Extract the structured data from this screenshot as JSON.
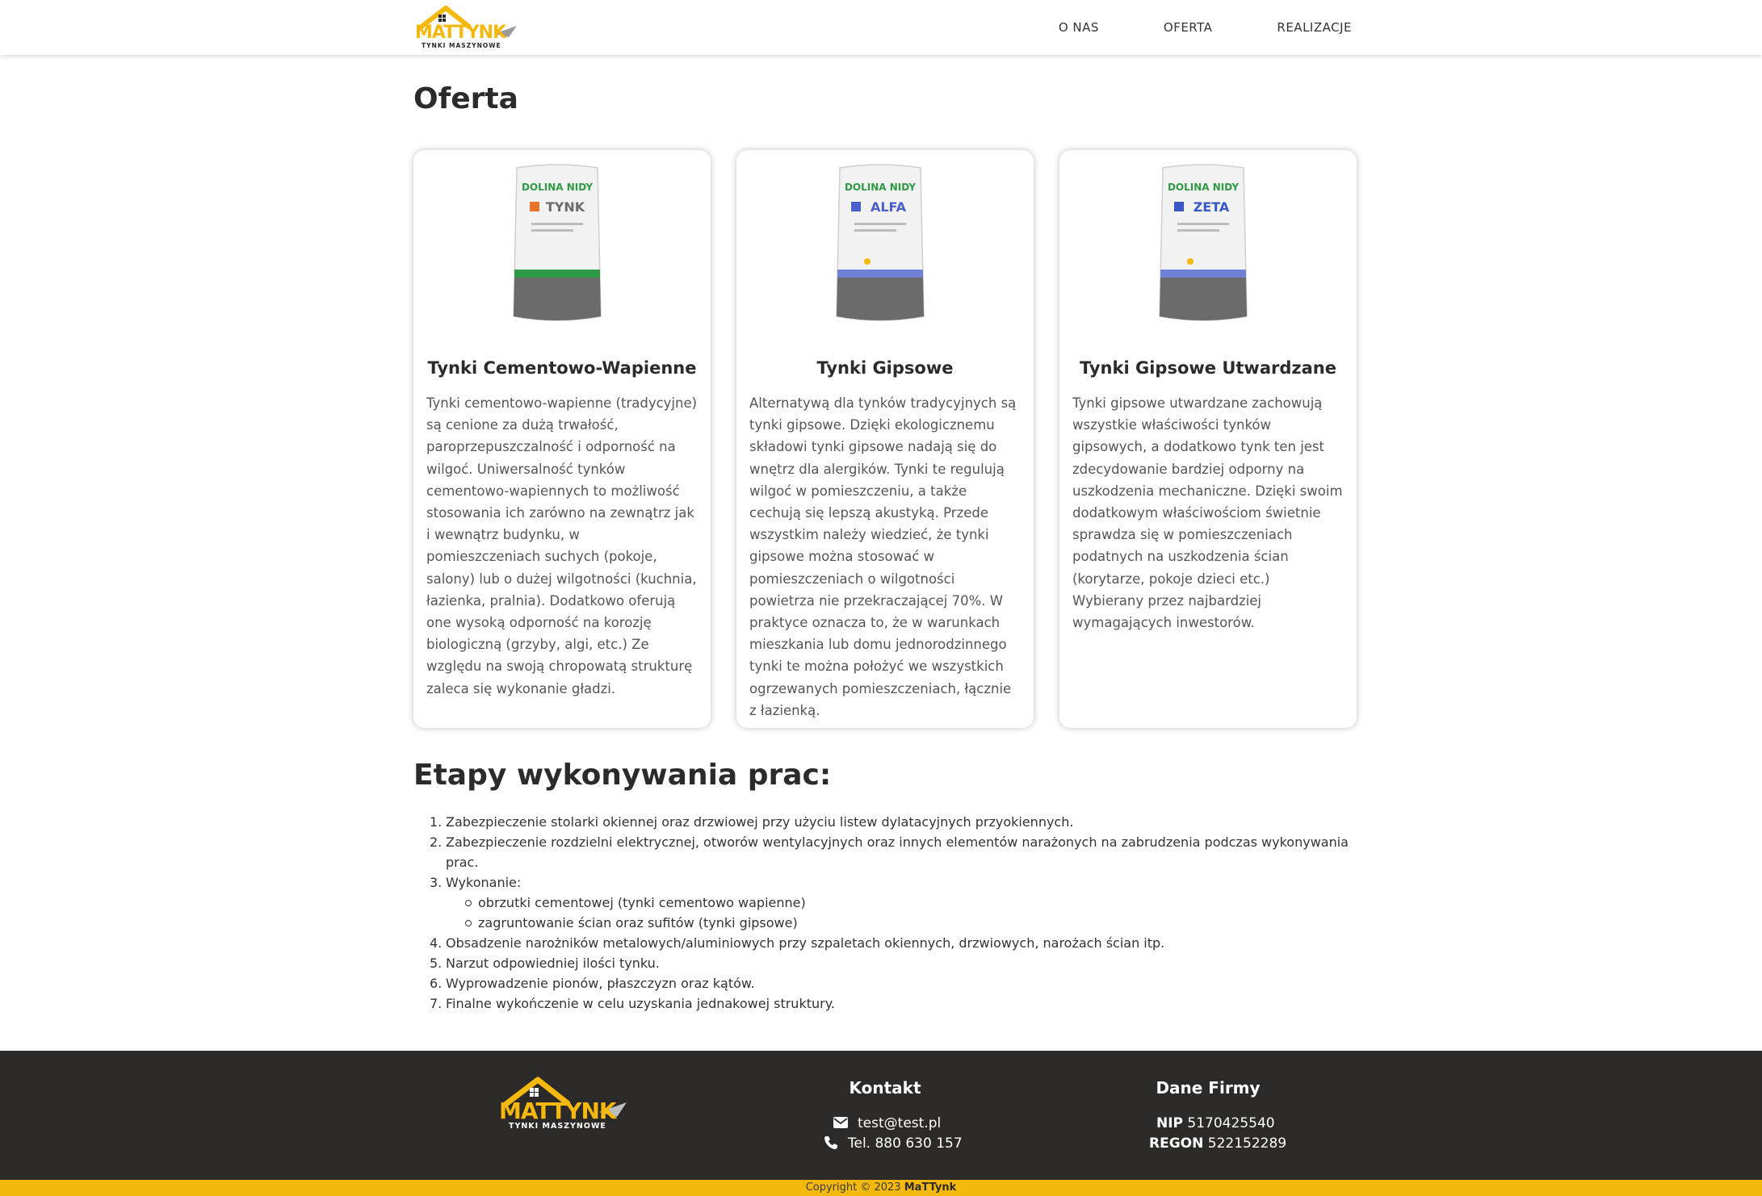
{
  "header": {
    "logo": {
      "brand_main": "MATTYNK",
      "brand_sub": "TYNKI MASZYNOWE"
    },
    "nav": [
      {
        "label": "O NAS"
      },
      {
        "label": "OFERTA"
      },
      {
        "label": "REALIZACJE"
      }
    ]
  },
  "main": {
    "title": "Oferta",
    "cards": [
      {
        "title": "Tynki Cementowo-Wapienne",
        "bag": {
          "brand": "DOLINA NIDY",
          "product": "TYNK",
          "stripe_color": "#2f9a45",
          "accent_color": "#e8742a"
        },
        "text": "Tynki cementowo-wapienne (tradycyjne) są cenione za dużą trwałość, paroprzepuszczalność i odporność na wilgoć. Uniwersalność tynków cementowo-wapiennych to możliwość stosowania ich zarówno na zewnątrz jak i wewnątrz budynku, w pomieszczeniach suchych (pokoje, salony) lub o dużej wilgotności (kuchnia, łazienka, pralnia). Dodatkowo oferują one wysoką odporność na korozję biologiczną (grzyby, algi, etc.) Ze względu na swoją chropowatą strukturę zaleca się wykonanie gładzi."
      },
      {
        "title": "Tynki Gipsowe",
        "bag": {
          "brand": "DOLINA NIDY",
          "product": "ALFA",
          "stripe_color": "#6f7fd6",
          "accent_color": "#4a60c8"
        },
        "text": "Alternatywą dla tynków tradycyjnych są tynki gipsowe. Dzięki ekologicznemu składowi tynki gipsowe nadają się do wnętrz dla alergików. Tynki te regulują wilgoć w pomieszczeniu, a także cechują się lepszą akustyką. Przede wszystkim należy wiedzieć, że tynki gipsowe można stosować w pomieszczeniach o wilgotności powietrza nie przekraczającej 70%. W praktyce oznacza to, że w warunkach mieszkania lub domu jednorodzinnego tynki te można położyć we wszystkich ogrzewanych pomieszczeniach, łącznie z łazienką."
      },
      {
        "title": "Tynki Gipsowe Utwardzane",
        "bag": {
          "brand": "DOLINA NIDY",
          "product": "ZETA",
          "stripe_color": "#6f7fd6",
          "accent_color": "#3a57c6"
        },
        "text": "Tynki gipsowe utwardzane zachowują wszystkie właściwości tynków gipsowych, a dodatkowo tynk ten jest zdecydowanie bardziej odporny na uszkodzenia mechaniczne. Dzięki swoim dodatkowym właściwościom świetnie sprawdza się w pomieszczeniach podatnych na uszkodzenia ścian (korytarze, pokoje dzieci etc.) Wybierany przez najbardziej wymagających inwestorów."
      }
    ],
    "steps_title": "Etapy wykonywania prac:",
    "steps": [
      {
        "num": "1.",
        "text": "Zabezpieczenie stolarki okiennej oraz drzwiowej przy użyciu listew dylatacyjnych przyokiennych."
      },
      {
        "num": "2.",
        "text": "Zabezpieczenie rozdzielni elektrycznej, otworów wentylacyjnych oraz innych elementów narażonych na zabrudzenia podczas wykonywania prac."
      },
      {
        "num": "3.",
        "text": "Wykonanie:",
        "sub": [
          "obrzutki cementowej (tynki cementowo wapienne)",
          "zagruntowanie ścian oraz sufitów (tynki gipsowe)"
        ]
      },
      {
        "num": "4.",
        "text": "Obsadzenie narożników metalowych/aluminiowych przy szpaletach okiennych, drzwiowych, narożach ścian itp."
      },
      {
        "num": "5.",
        "text": "Narzut odpowiedniej ilości tynku."
      },
      {
        "num": "6.",
        "text": "Wyprowadzenie pionów, płaszczyzn oraz kątów."
      },
      {
        "num": "7.",
        "text": "Finalne wykończenie w celu uzyskania jednakowej struktury."
      }
    ]
  },
  "footer": {
    "logo": {
      "brand_main": "MATTYNK",
      "brand_sub": "TYNKI MASZYNOWE"
    },
    "contact": {
      "title": "Kontakt",
      "email": "test@test.pl",
      "phone": "Tel. 880 630 157"
    },
    "company": {
      "title": "Dane Firmy",
      "nip_label": "NIP",
      "nip": "5170425540",
      "regon_label": "REGON",
      "regon": "522152289"
    },
    "copyright": {
      "text": "Copyright © 2023",
      "brand": "MaTTynk"
    }
  },
  "colors": {
    "accent": "#f5b80c",
    "footer_bg": "#2b2a29",
    "text": "#2b2b2b"
  }
}
